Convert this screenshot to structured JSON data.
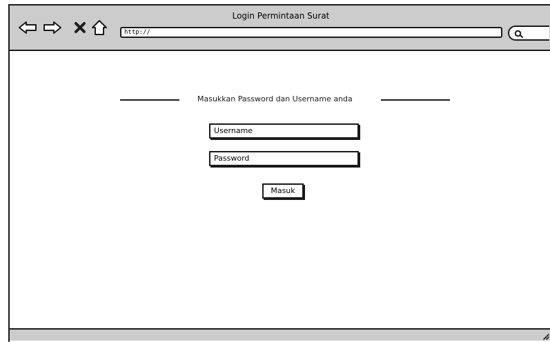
{
  "window": {
    "title": "Login Permintaan Surat"
  },
  "toolbar": {
    "url": "http://",
    "icons": [
      "back-arrow-icon",
      "forward-arrow-icon",
      "close-icon",
      "home-icon",
      "search-icon"
    ]
  },
  "form": {
    "heading": "Masukkan Password dan Username anda",
    "username_value": "Username",
    "password_value": "Password",
    "submit_label": "Masuk"
  },
  "colors": {
    "chrome": "#cccccc",
    "border": "#1a1a1a",
    "background": "#ffffff"
  }
}
